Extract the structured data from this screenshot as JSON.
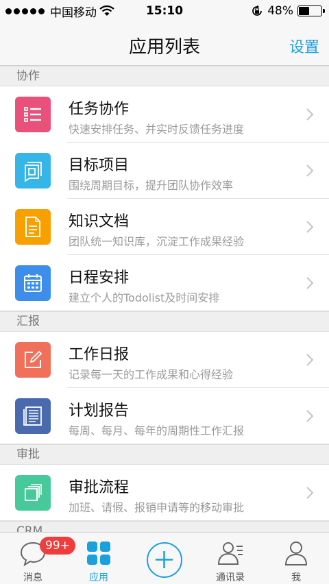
{
  "status": {
    "carrier": "中国移动",
    "time": "15:10",
    "battery": "48%",
    "battery_level": 0.48
  },
  "nav": {
    "title": "应用列表",
    "action": "设置"
  },
  "sections": [
    {
      "header": "协作",
      "items": [
        {
          "title": "任务协作",
          "desc": "快速安排任务、并实时反馈任务进度",
          "icon": "task-list-icon",
          "color": "#e9517a"
        },
        {
          "title": "目标项目",
          "desc": "围绕周期目标，提升团队协作效率",
          "icon": "target-icon",
          "color": "#36b5e8"
        },
        {
          "title": "知识文档",
          "desc": "团队统一知识库，沉淀工作成果经验",
          "icon": "document-icon",
          "color": "#f8a000"
        },
        {
          "title": "日程安排",
          "desc": "建立个人的Todolist及时间安排",
          "icon": "calendar-icon",
          "color": "#3d8eea"
        }
      ]
    },
    {
      "header": "汇报",
      "items": [
        {
          "title": "工作日报",
          "desc": "记录每一天的工作成果和心得经验",
          "icon": "edit-icon",
          "color": "#f0705a"
        },
        {
          "title": "计划报告",
          "desc": "每周、每月、每年的周期性工作汇报",
          "icon": "report-icon",
          "color": "#4a6aae"
        }
      ]
    },
    {
      "header": "审批",
      "items": [
        {
          "title": "审批流程",
          "desc": "加班、请假、报销申请等的移动审批",
          "icon": "approval-icon",
          "color": "#48c99c"
        }
      ]
    },
    {
      "header": "CRM",
      "items": []
    }
  ],
  "tabs": [
    {
      "label": "消息",
      "icon": "chat-bubble-icon",
      "badge": "99+"
    },
    {
      "label": "应用",
      "icon": "apps-grid-icon",
      "active": true
    },
    {
      "label": "",
      "icon": "plus-icon"
    },
    {
      "label": "通讯录",
      "icon": "contacts-icon"
    },
    {
      "label": "我",
      "icon": "person-icon"
    }
  ],
  "colors": {
    "accent": "#1aa0dd",
    "badge": "#f03c3c"
  }
}
